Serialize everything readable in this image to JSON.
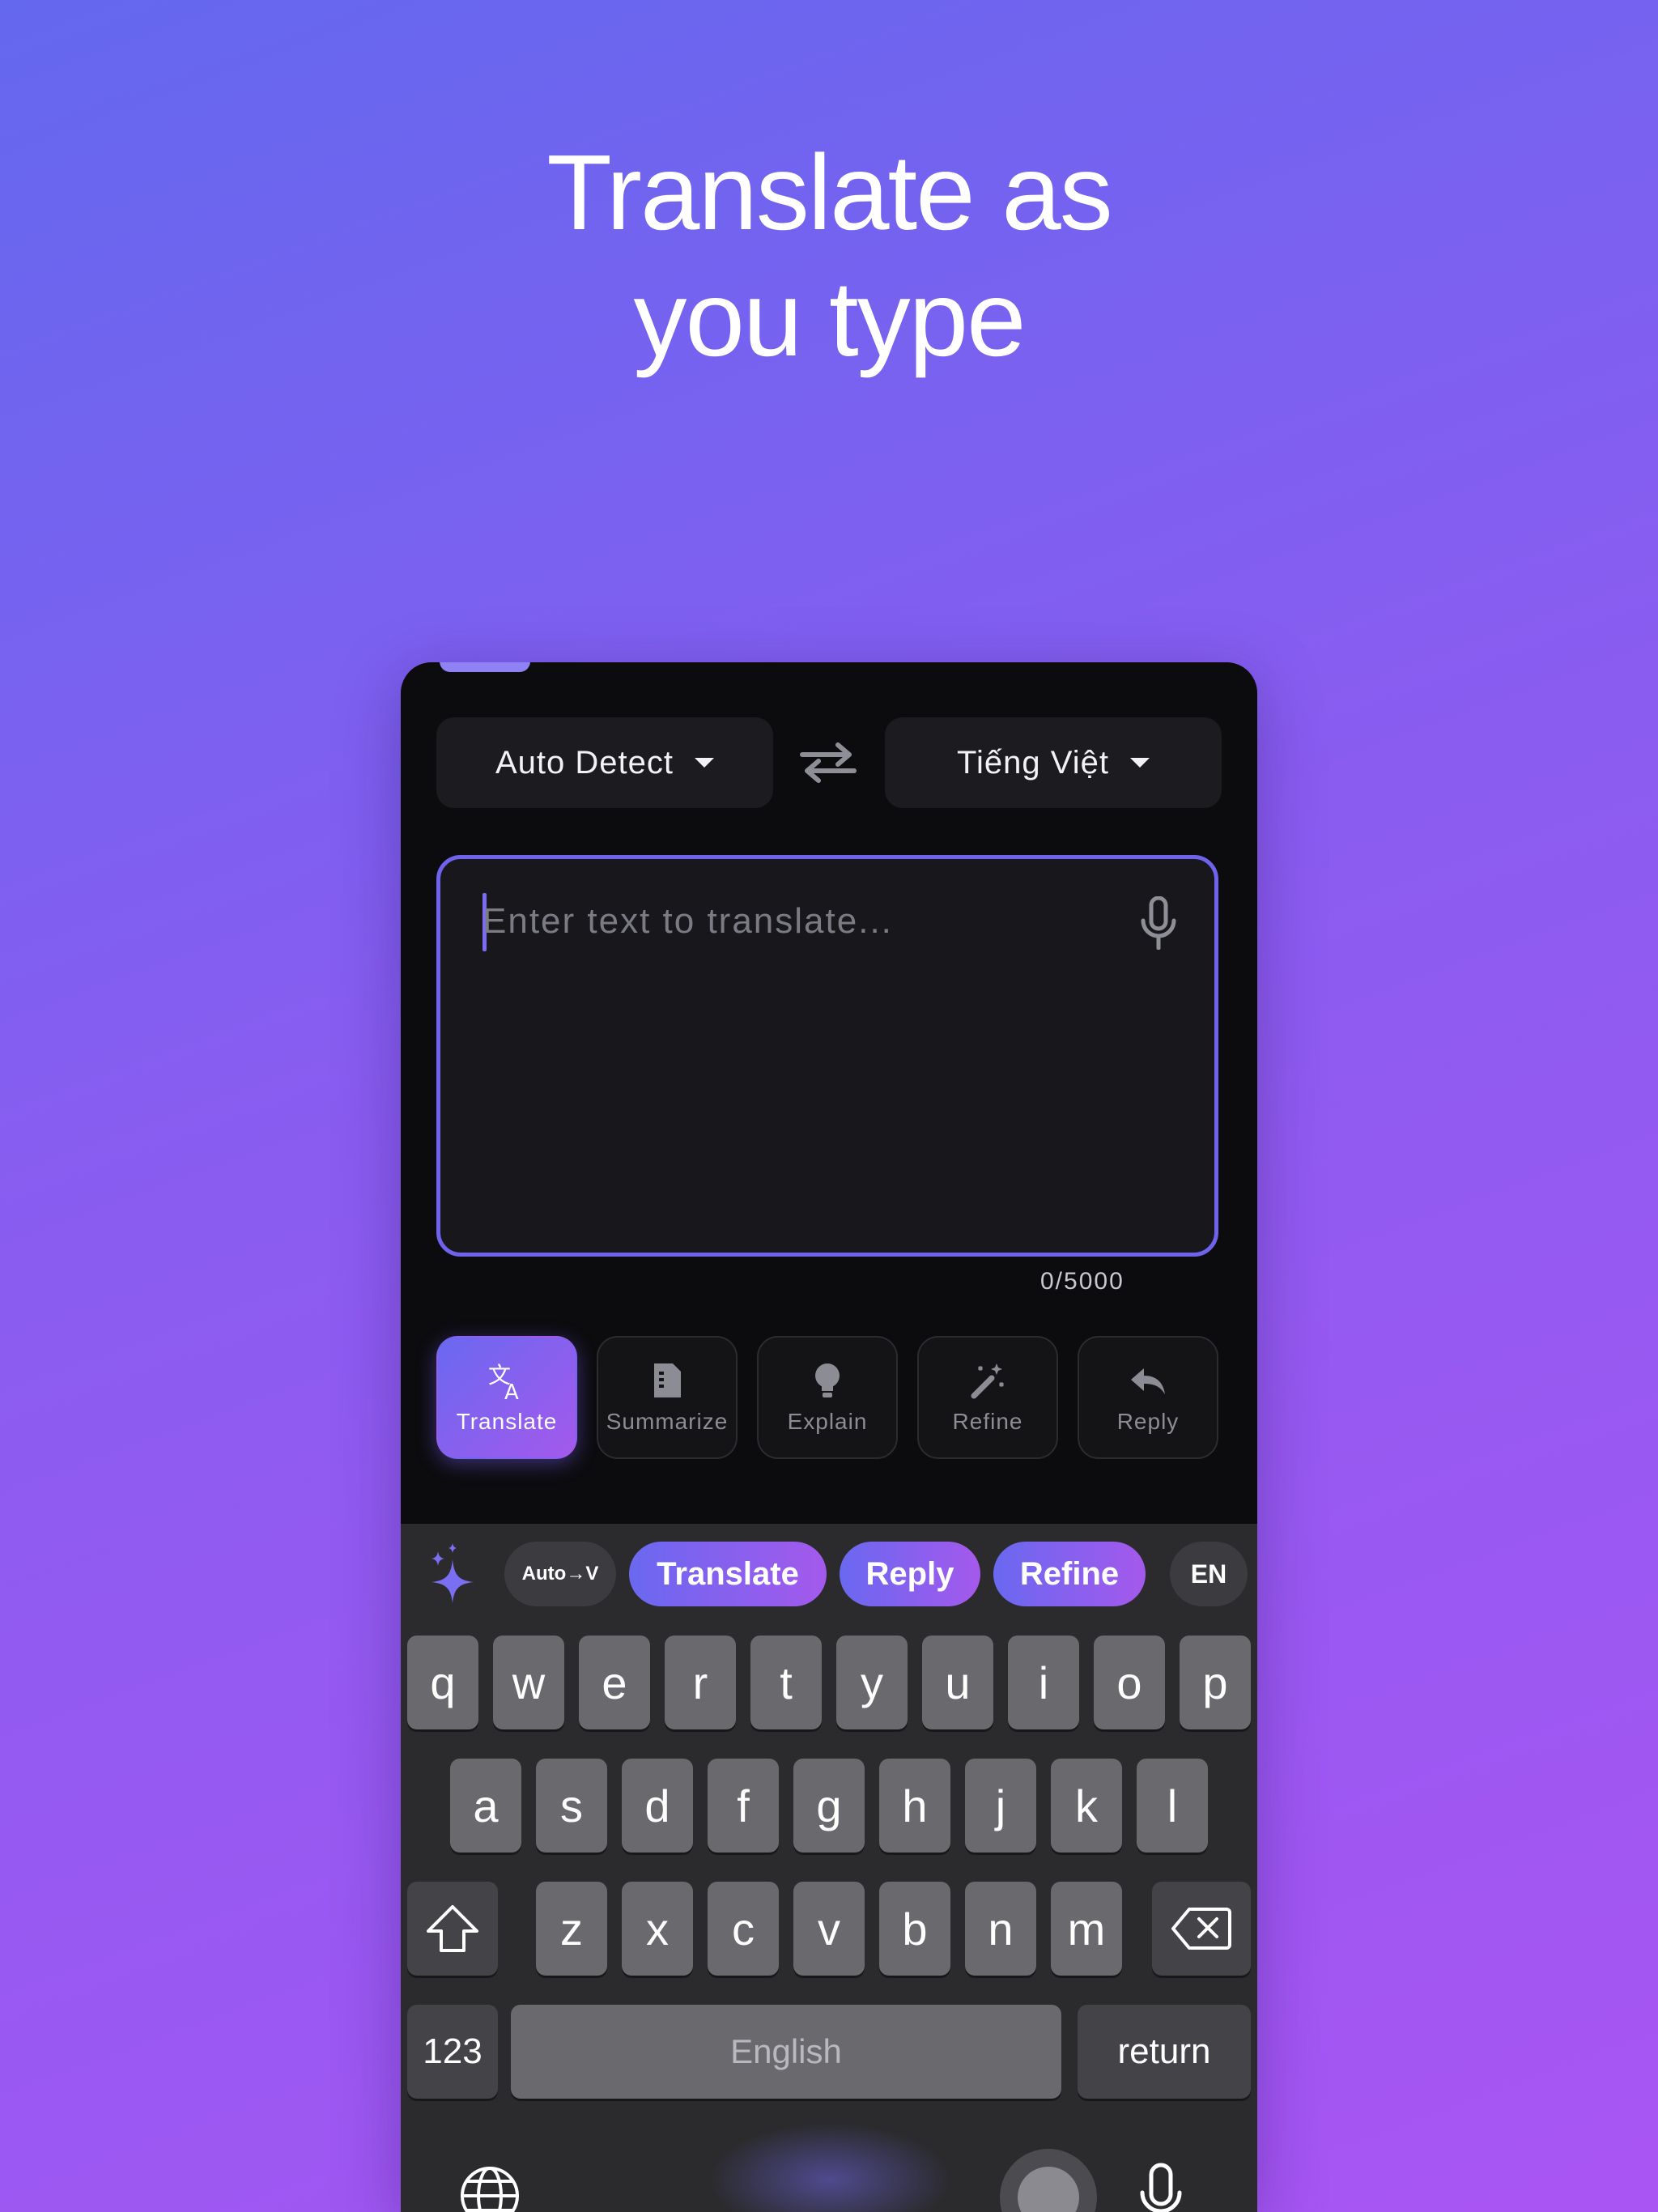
{
  "headline": {
    "line1": "Translate as",
    "line2": "you type"
  },
  "languages": {
    "source": "Auto Detect",
    "target": "Tiếng Việt"
  },
  "input": {
    "placeholder": "Enter text to translate...",
    "counter": "0/5000"
  },
  "tools": [
    {
      "label": "Translate",
      "icon": "translate-icon",
      "active": true
    },
    {
      "label": "Summarize",
      "icon": "document-icon",
      "active": false
    },
    {
      "label": "Explain",
      "icon": "lightbulb-icon",
      "active": false
    },
    {
      "label": "Refine",
      "icon": "magic-wand-icon",
      "active": false
    },
    {
      "label": "Reply",
      "icon": "reply-icon",
      "active": false
    }
  ],
  "suggestions": {
    "lang_pair": "Auto→V",
    "chips": [
      "Translate",
      "Reply",
      "Refine"
    ],
    "lang_code": "EN"
  },
  "keyboard": {
    "row1": [
      "q",
      "w",
      "e",
      "r",
      "t",
      "y",
      "u",
      "i",
      "o",
      "p"
    ],
    "row2": [
      "a",
      "s",
      "d",
      "f",
      "g",
      "h",
      "j",
      "k",
      "l"
    ],
    "row3": [
      "z",
      "x",
      "c",
      "v",
      "b",
      "n",
      "m"
    ],
    "numbers": "123",
    "space": "English",
    "return": "return"
  },
  "colors": {
    "accent": "#6f63ee",
    "gradient_start": "#6a68f0",
    "gradient_end": "#a459ec"
  }
}
